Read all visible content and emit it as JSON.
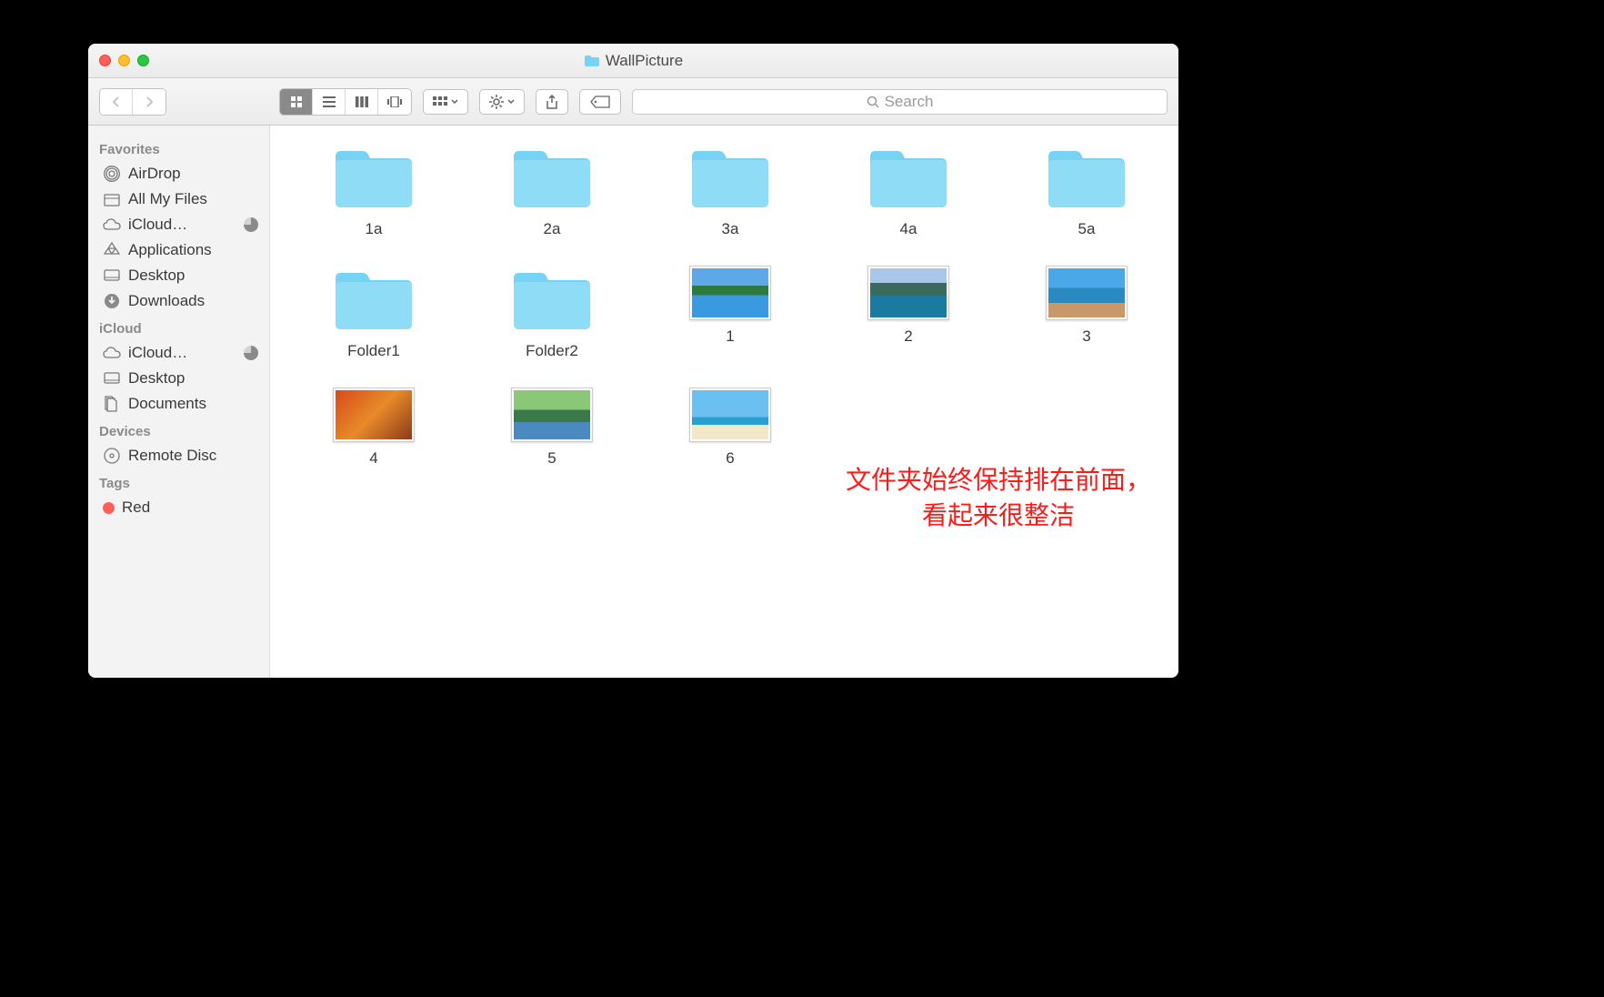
{
  "window": {
    "title": "WallPicture"
  },
  "search": {
    "placeholder": "Search"
  },
  "sidebar": {
    "sections": [
      {
        "label": "Favorites",
        "items": [
          {
            "label": "AirDrop",
            "icon": "airdrop"
          },
          {
            "label": "All My Files",
            "icon": "allmyfiles"
          },
          {
            "label": "iCloud…",
            "icon": "cloud",
            "pie": true
          },
          {
            "label": "Applications",
            "icon": "apps"
          },
          {
            "label": "Desktop",
            "icon": "desktop"
          },
          {
            "label": "Downloads",
            "icon": "downloads"
          }
        ]
      },
      {
        "label": "iCloud",
        "items": [
          {
            "label": "iCloud…",
            "icon": "cloud",
            "pie": true
          },
          {
            "label": "Desktop",
            "icon": "desktop"
          },
          {
            "label": "Documents",
            "icon": "documents"
          }
        ]
      },
      {
        "label": "Devices",
        "items": [
          {
            "label": "Remote Disc",
            "icon": "disc"
          }
        ]
      },
      {
        "label": "Tags",
        "items": [
          {
            "label": "Red",
            "icon": "tag-red"
          }
        ]
      }
    ]
  },
  "items": [
    {
      "type": "folder",
      "label": "1a"
    },
    {
      "type": "folder",
      "label": "2a"
    },
    {
      "type": "folder",
      "label": "3a"
    },
    {
      "type": "folder",
      "label": "4a"
    },
    {
      "type": "folder",
      "label": "5a"
    },
    {
      "type": "folder",
      "label": "Folder1"
    },
    {
      "type": "folder",
      "label": "Folder2"
    },
    {
      "type": "image",
      "label": "1",
      "thumb": "lake-green"
    },
    {
      "type": "image",
      "label": "2",
      "thumb": "mountain-lake"
    },
    {
      "type": "image",
      "label": "3",
      "thumb": "pool"
    },
    {
      "type": "image",
      "label": "4",
      "thumb": "autumn"
    },
    {
      "type": "image",
      "label": "5",
      "thumb": "forest-river"
    },
    {
      "type": "image",
      "label": "6",
      "thumb": "beach"
    }
  ],
  "annotation": {
    "line1": "文件夹始终保持排在前面，",
    "line2": "看起来很整洁"
  }
}
